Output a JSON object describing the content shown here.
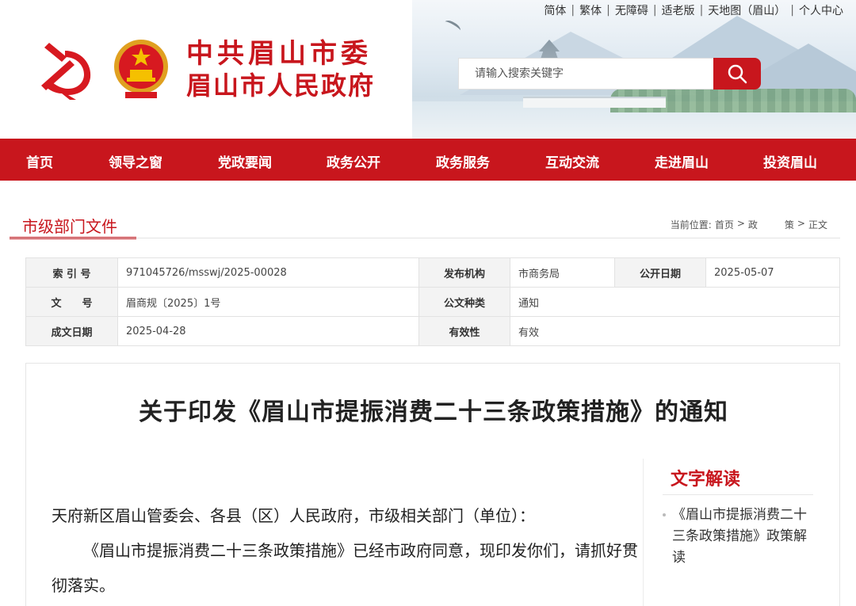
{
  "top_links": [
    "简体",
    "繁体",
    "无障碍",
    "适老版",
    "天地图（眉山）",
    "个人中心"
  ],
  "site": {
    "title_line1": "中共眉山市委",
    "title_line2": "眉山市人民政府"
  },
  "search": {
    "placeholder": "请输入搜索关键字"
  },
  "nav": [
    "首页",
    "领导之窗",
    "党政要闻",
    "政务公开",
    "政务服务",
    "互动交流",
    "走进眉山",
    "投资眉山"
  ],
  "section": {
    "title": "市级部门文件",
    "breadcrumb_label": "当前位置:",
    "breadcrumb": [
      "首页",
      ">",
      "政",
      "",
      "策",
      ">",
      "正文"
    ]
  },
  "meta": {
    "row1": {
      "k1": "索 引 号",
      "v1": "971045726/msswj/2025-00028",
      "k2": "发布机构",
      "v2": "市商务局",
      "k3": "公开日期",
      "v3": "2025-05-07"
    },
    "row2": {
      "k1": "文　　号",
      "v1": "眉商规〔2025〕1号",
      "k2": "公文种类",
      "v2": "通知"
    },
    "row3": {
      "k1": "成文日期",
      "v1": "2025-04-28",
      "k2": "有效性",
      "v2": "有效"
    }
  },
  "doc": {
    "title": "关于印发《眉山市提振消费二十三条政策措施》的通知",
    "salutation": "天府新区眉山管委会、各县（区）人民政府，市级相关部门（单位）：",
    "paragraph1": "《眉山市提振消费二十三条政策措施》已经市政府同意，现印发你们，请抓好贯彻落实。"
  },
  "sidebar": {
    "title": "文字解读",
    "item": "《眉山市提振消费二十三条政策措施》政策解读"
  },
  "colors": {
    "brand_red": "#c8161d"
  }
}
